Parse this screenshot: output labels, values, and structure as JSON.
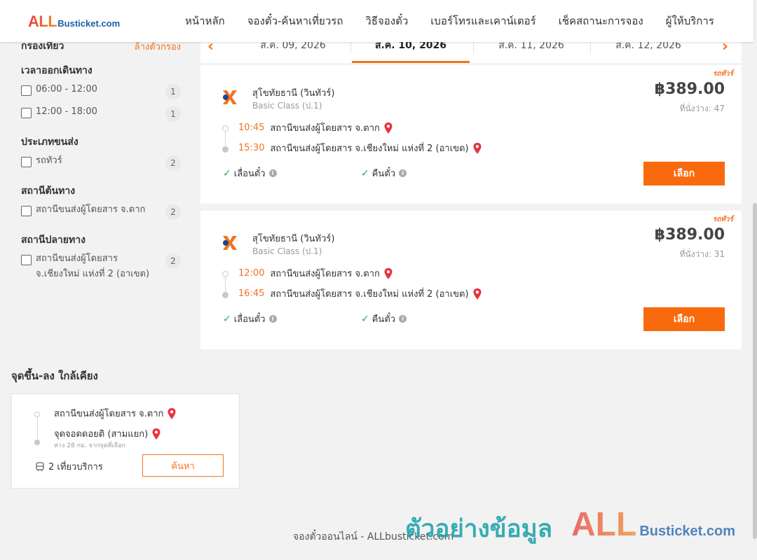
{
  "header": {
    "logo_all": "ALL",
    "logo_bus": "Busticket.com",
    "nav": [
      "หน้าหลัก",
      "จองตั๋ว-ค้นหาเที่ยวรถ",
      "วิธีจองตั๋ว",
      "เบอร์โทรและเคาน์เตอร์",
      "เช็คสถานะการจอง",
      "ผู้ให้บริการ"
    ]
  },
  "filter": {
    "title": "กรองเที่ยว",
    "clear": "ล้างตัวกรอง",
    "departure": {
      "title": "เวลาออกเดินทาง",
      "options": [
        {
          "label": "06:00 - 12:00",
          "count": "1"
        },
        {
          "label": "12:00 - 18:00",
          "count": "1"
        }
      ]
    },
    "vehicle": {
      "title": "ประเภทขนส่ง",
      "options": [
        {
          "label": "รถทัวร์",
          "count": "2"
        }
      ]
    },
    "origin": {
      "title": "สถานีต้นทาง",
      "options": [
        {
          "label": "สถานีขนส่งผู้โดยสาร จ.ตาก",
          "count": "2"
        }
      ]
    },
    "destination": {
      "title": "สถานีปลายทาง",
      "options": [
        {
          "label_1": "สถานีขนส่งผู้โดยสาร",
          "label_2": "จ.เชียงใหม่ แห่งที่ 2 (อาเขต)",
          "count": "2"
        }
      ]
    }
  },
  "dates": {
    "tabs": [
      "ส.ค. 09, 2026",
      "ส.ค. 10, 2026",
      "ส.ค. 11, 2026",
      "ส.ค. 12, 2026"
    ],
    "active_index": 1
  },
  "trips": [
    {
      "tag": "รถทัวร์",
      "operator": "สุโขทัยธานี (วินทัวร์)",
      "class": "Basic Class (ป.1)",
      "price": "฿389.00",
      "seats": "ที่นั่งว่าง: 47",
      "depart_time": "10:45",
      "depart_station": "สถานีขนส่งผู้โดยสาร จ.ตาก",
      "arrive_time": "15:30",
      "arrive_station": "สถานีขนส่งผู้โดยสาร จ.เชียงใหม่ แห่งที่ 2 (อาเขต)",
      "feature_1": "เลื่อนตั๋ว",
      "feature_2": "คืนตั๋ว",
      "button": "เลือก"
    },
    {
      "tag": "รถทัวร์",
      "operator": "สุโขทัยธานี (วินทัวร์)",
      "class": "Basic Class (ป.1)",
      "price": "฿389.00",
      "seats": "ที่นั่งว่าง: 31",
      "depart_time": "12:00",
      "depart_station": "สถานีขนส่งผู้โดยสาร จ.ตาก",
      "arrive_time": "16:45",
      "arrive_station": "สถานีขนส่งผู้โดยสาร จ.เชียงใหม่ แห่งที่ 2 (อาเขต)",
      "feature_1": "เลื่อนตั๋ว",
      "feature_2": "คืนตั๋ว",
      "button": "เลือก"
    }
  ],
  "nearby": {
    "title": "จุดขึ้น-ลง ใกล้เคียง",
    "from": "สถานีขนส่งผู้โดยสาร จ.ตาก",
    "to": "จุดจอดดอยติ (สามแยก)",
    "distance": "ห่าง 28 กม. จากจุดที่เลือก",
    "trips": "2 เที่ยวบริการ",
    "button": "ค้นหา"
  },
  "footer": "จองตั๋วออนไลน์ - ALLbusticket.com",
  "watermark": {
    "text": "ตัวอย่างข้อมูล",
    "logo_all": "ALL",
    "logo_bus": "Busticket.com"
  },
  "colors": {
    "accent": "#f47321",
    "button": "#f96a0c",
    "check": "#2eaa4a",
    "pin": "#e8313d"
  }
}
